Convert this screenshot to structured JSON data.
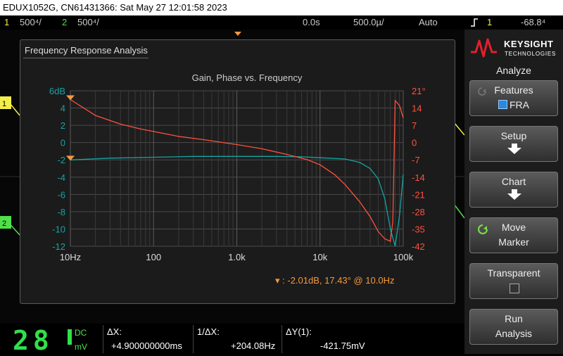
{
  "titlebar": {
    "text": "EDUX1052G, CN61431366: Sat May 27 12:01:58 2023"
  },
  "status": {
    "ch1_num": "1",
    "ch1_scale": "500⁴/",
    "ch2_num": "2",
    "ch2_scale": "500⁴/",
    "h_delay": "0.0s",
    "h_scale": "500.0µ/",
    "trigger_mode": "Auto",
    "trig_ch": "1",
    "trig_level": "-68.8⁴"
  },
  "fra": {
    "window_title": "Frequency Response Analysis",
    "marker_readout": "-2.01dB, 17.43° @ 10.0Hz",
    "marker_symbol": "▾ :"
  },
  "chart_data": {
    "type": "line",
    "title": "Gain, Phase vs. Frequency",
    "x_scale": "log",
    "xlim": [
      10,
      100000
    ],
    "x_ticks": [
      "10Hz",
      "100",
      "1.0k",
      "10k",
      "100k"
    ],
    "y_left_ticks": [
      "6dB",
      "4",
      "2",
      "0",
      "-2",
      "-4",
      "-6",
      "-8",
      "-10",
      "-12"
    ],
    "y_left_lim": [
      -12,
      6
    ],
    "y_right_ticks": [
      "21°",
      "14",
      "7",
      "0",
      "-7",
      "-14",
      "-21",
      "-28",
      "-35",
      "-42"
    ],
    "y_right_lim": [
      -42,
      21
    ],
    "grid": true,
    "series": [
      {
        "axis": "left",
        "color": "#17a3a3",
        "x": [
          10,
          30,
          100,
          300,
          1000,
          3000,
          6000,
          10000,
          20000,
          30000,
          40000,
          50000,
          60000,
          70000,
          80000,
          90000,
          100000
        ],
        "y": [
          -2.01,
          -1.8,
          -1.7,
          -1.6,
          -1.6,
          -1.6,
          -1.65,
          -1.75,
          -1.9,
          -2.3,
          -3.0,
          -4.2,
          -6.5,
          -10.0,
          -12.0,
          -8.5,
          -3.7
        ]
      },
      {
        "axis": "right",
        "color": "#ff5040",
        "x": [
          10,
          20,
          40,
          70,
          100,
          200,
          400,
          1000,
          2000,
          4000,
          7000,
          10000,
          15000,
          20000,
          30000,
          40000,
          50000,
          60000,
          70000,
          75000,
          80000,
          90000,
          100000
        ],
        "y": [
          17.43,
          11,
          7.5,
          5.5,
          4.5,
          2.5,
          1.2,
          -0.8,
          -2.5,
          -4.8,
          -6.9,
          -9.0,
          -13,
          -17,
          -24,
          -30,
          -36,
          -39,
          -40,
          -32,
          17,
          15,
          10
        ]
      }
    ],
    "markers": [
      {
        "axis": "left",
        "x": 10,
        "y": -2.01
      },
      {
        "axis": "right",
        "x": 10,
        "y": 17.43
      }
    ]
  },
  "panel": {
    "brand": "KEYSIGHT",
    "brand_sub": "TECHNOLOGIES",
    "menu_title": "Analyze",
    "features_label": "Features",
    "features_value": "FRA",
    "setup_label": "Setup",
    "chart_label": "Chart",
    "move_label1": "Move",
    "move_label2": "Marker",
    "transparent_label": "Transparent",
    "run_label1": "Run",
    "run_label2": "Analysis"
  },
  "measure": {
    "big_value": "28",
    "coupling": "DC",
    "unit": "mV",
    "dx_label": "ΔX:",
    "dx_value": "+4.900000000ms",
    "inv_dx_label": "1/ΔX:",
    "inv_dx_value": "+204.08Hz",
    "dy_label": "ΔY(1):",
    "dy_value": "-421.75mV"
  },
  "colors": {
    "ch1": "#f2ef4a",
    "ch2": "#4fe04a",
    "marker": "#f39a3e",
    "gain": "#17a3a3",
    "phase": "#ff5040"
  }
}
